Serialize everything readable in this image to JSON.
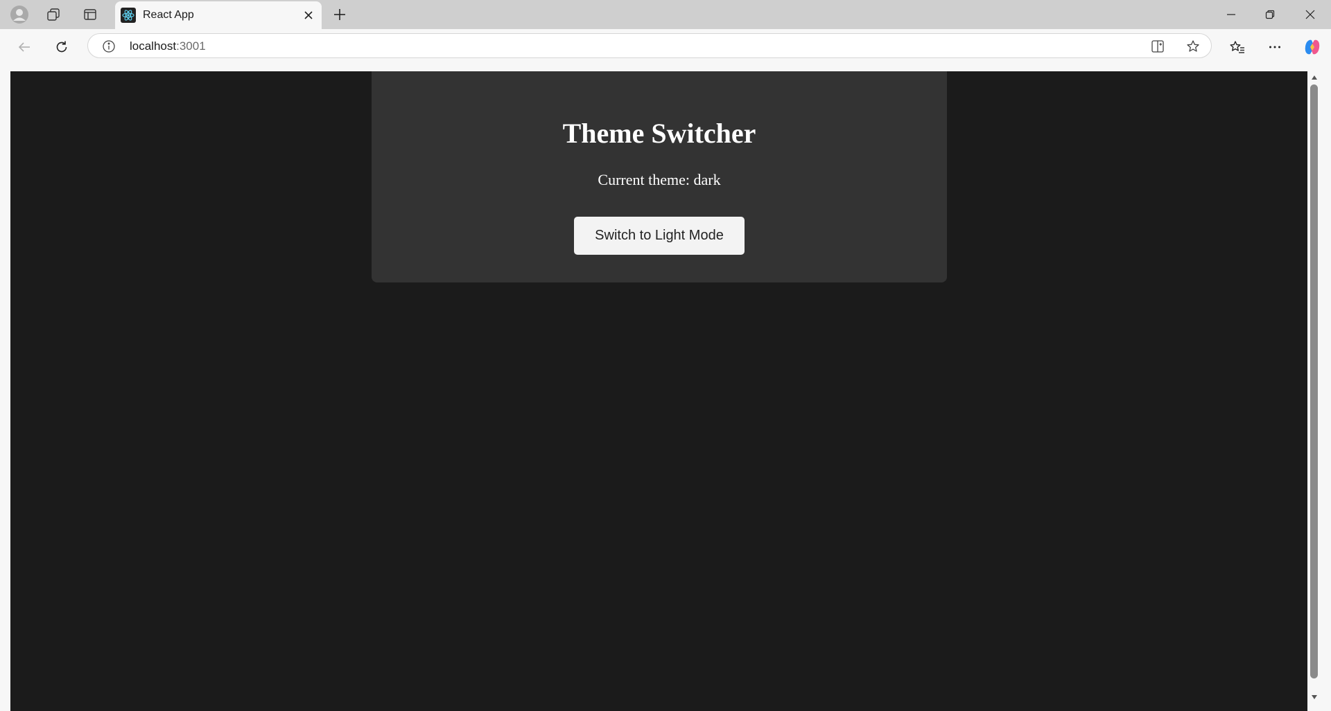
{
  "browser": {
    "tab": {
      "title": "React App",
      "favicon": "react-logo-icon"
    },
    "address": {
      "host": "localhost",
      "port": ":3001"
    },
    "icons": {
      "profile": "profile-icon",
      "workspaces": "workspaces-icon",
      "tab_actions": "vertical-tabs-icon",
      "new_tab": "plus-icon",
      "back": "back-arrow-icon",
      "refresh": "refresh-icon",
      "site_info": "info-icon",
      "split_screen": "split-screen-icon",
      "favorite": "star-icon",
      "favorites_bar": "favorites-icon",
      "more": "more-icon",
      "copilot": "copilot-icon"
    }
  },
  "app": {
    "title": "Theme Switcher",
    "current_theme_text": "Current theme: dark",
    "switch_button_label": "Switch to Light Mode"
  },
  "colors": {
    "page_background": "#1b1b1b",
    "card_background": "#333333",
    "button_background": "#f3f3f3",
    "text": "#ffffff"
  }
}
